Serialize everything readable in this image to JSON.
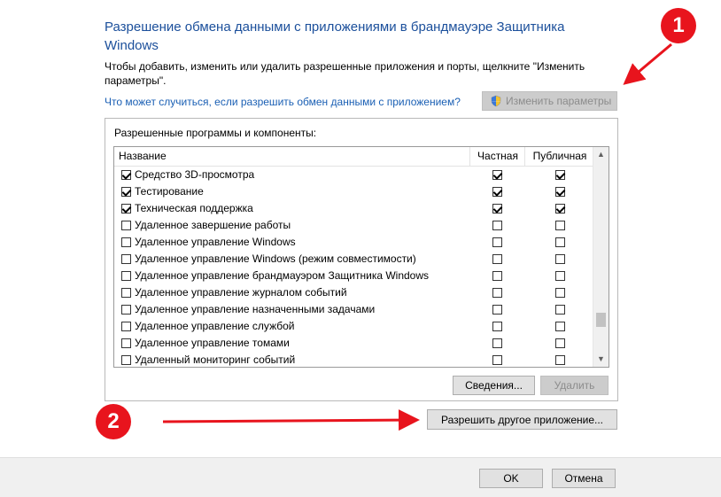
{
  "header": {
    "title": "Разрешение обмена данными с приложениями в брандмауэре Защитника Windows",
    "subtitle": "Чтобы добавить, изменить или удалить разрешенные приложения и порты, щелкните \"Изменить параметры\".",
    "help_link": "Что может случиться, если разрешить обмен данными с приложением?",
    "change_settings": "Изменить параметры"
  },
  "group": {
    "label": "Разрешенные программы и компоненты:",
    "columns": {
      "name": "Название",
      "private": "Частная",
      "public": "Публичная"
    },
    "rows": [
      {
        "name": "Средство 3D-просмотра",
        "enabled": true,
        "private": true,
        "public": true
      },
      {
        "name": "Тестирование",
        "enabled": true,
        "private": true,
        "public": true
      },
      {
        "name": "Техническая поддержка",
        "enabled": true,
        "private": true,
        "public": true
      },
      {
        "name": "Удаленное завершение работы",
        "enabled": false,
        "private": false,
        "public": false
      },
      {
        "name": "Удаленное управление Windows",
        "enabled": false,
        "private": false,
        "public": false
      },
      {
        "name": "Удаленное управление Windows (режим совместимости)",
        "enabled": false,
        "private": false,
        "public": false
      },
      {
        "name": "Удаленное управление брандмауэром Защитника Windows",
        "enabled": false,
        "private": false,
        "public": false
      },
      {
        "name": "Удаленное управление журналом событий",
        "enabled": false,
        "private": false,
        "public": false
      },
      {
        "name": "Удаленное управление назначенными задачами",
        "enabled": false,
        "private": false,
        "public": false
      },
      {
        "name": "Удаленное управление службой",
        "enabled": false,
        "private": false,
        "public": false
      },
      {
        "name": "Удаленное управление томами",
        "enabled": false,
        "private": false,
        "public": false
      },
      {
        "name": "Удаленный мониторинг событий",
        "enabled": false,
        "private": false,
        "public": false
      }
    ],
    "details_button": "Сведения...",
    "delete_button": "Удалить"
  },
  "allow_other_button": "Разрешить другое приложение...",
  "footer": {
    "ok": "OK",
    "cancel": "Отмена"
  },
  "annotations": {
    "badge1": "1",
    "badge2": "2",
    "color": "#e8141d"
  },
  "icons": {
    "change_settings": "uac-shield-icon",
    "scroll_up": "chevron-up-icon",
    "scroll_down": "chevron-down-icon"
  }
}
